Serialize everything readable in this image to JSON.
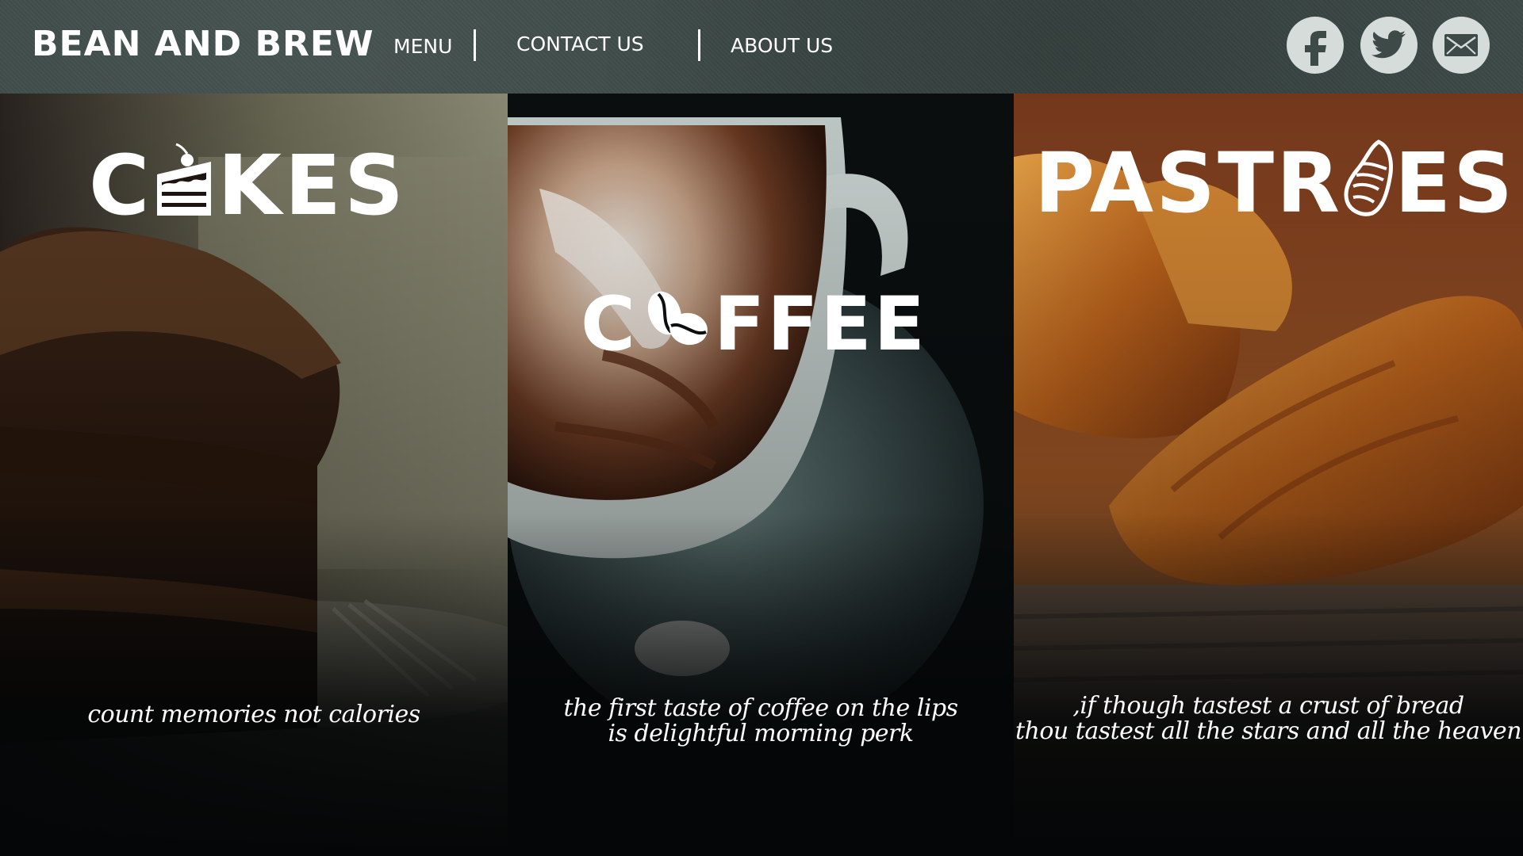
{
  "header": {
    "brand": "BEAN AND BREW",
    "nav": [
      "MENU",
      "CONTACT US",
      "ABOUT US"
    ],
    "social": [
      "facebook-icon",
      "twitter-icon",
      "mail-icon"
    ]
  },
  "panels": [
    {
      "title_before": "C",
      "title_after": "KES",
      "title_icon": "cake-slice-icon",
      "tagline": [
        "count memories not calories"
      ]
    },
    {
      "title_before": "C",
      "title_after": "FFEE",
      "title_icon": "coffee-beans-icon",
      "tagline": [
        "the first taste of coffee on the lips",
        "is delightful morning perk"
      ]
    },
    {
      "title_before": "PASTR",
      "title_after": "ES",
      "title_icon": "croissant-icon",
      "tagline": [
        ",if though tastest a crust of bread",
        "thou tastest all the stars and all the heaven"
      ]
    }
  ],
  "colors": {
    "header_bg": "#3d4a47",
    "text": "#ffffff",
    "social_circle": "#d6dcda",
    "social_glyph": "#3d4a47"
  }
}
